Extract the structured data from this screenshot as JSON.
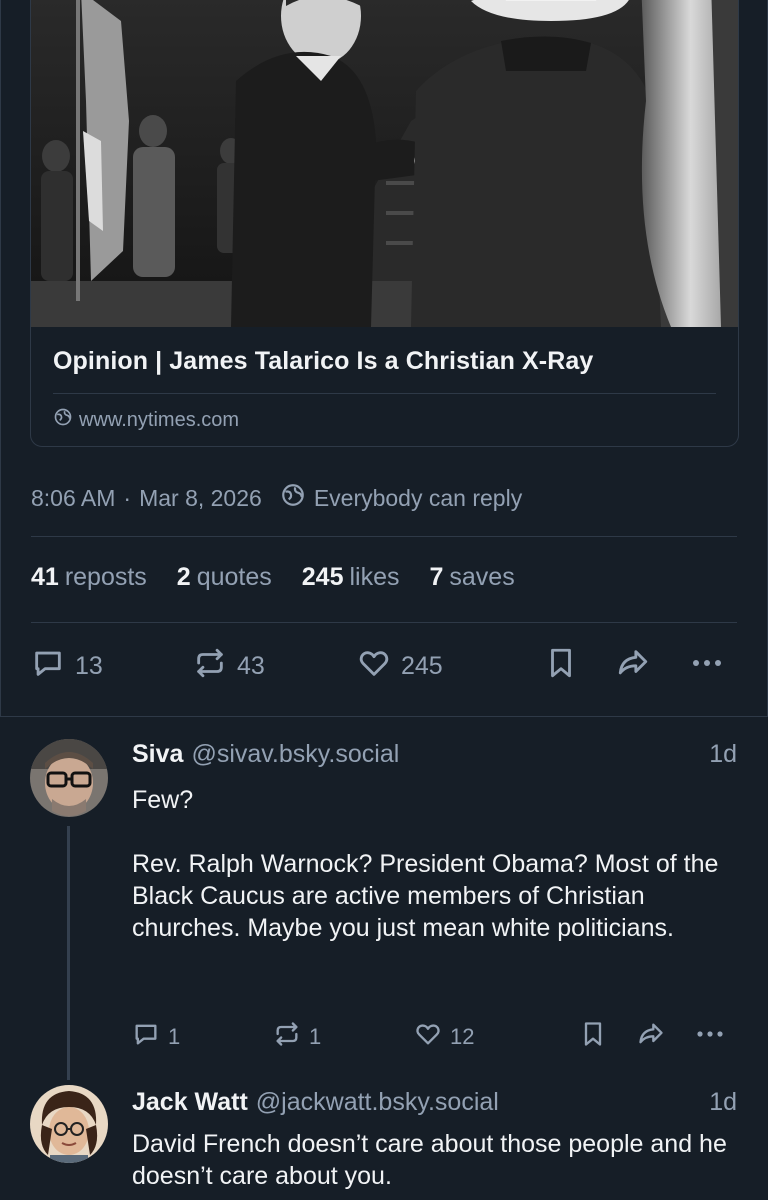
{
  "link_card": {
    "title": "Opinion | James Talarico Is a Christian X-Ray",
    "domain": "www.nytimes.com",
    "image_alt": "Black and white photo of a man in a suit greeting a man in a cowboy hat on a stage with flags"
  },
  "post_meta": {
    "time": "8:06 AM",
    "separator": "·",
    "date": "Mar 8, 2026",
    "reply_setting": "Everybody can reply"
  },
  "stats": {
    "reposts_count": "41",
    "reposts_label": "reposts",
    "quotes_count": "2",
    "quotes_label": "quotes",
    "likes_count": "245",
    "likes_label": "likes",
    "saves_count": "7",
    "saves_label": "saves"
  },
  "actions": {
    "replies": "13",
    "reposts": "43",
    "likes": "245"
  },
  "replies": [
    {
      "name": "Siva",
      "handle": "@sivav.bsky.social",
      "time": "1d",
      "body": "Few?\n\nRev. Ralph Warnock? President Obama? Most of the Black Caucus are active members of Christian churches. Maybe you just mean white politicians.",
      "reply_count": "1",
      "repost_count": "1",
      "like_count": "12"
    },
    {
      "name": "Jack Watt",
      "handle": "@jackwatt.bsky.social",
      "time": "1d",
      "body": "David French doesn’t care about those people and he doesn’t care about you."
    }
  ],
  "colors": {
    "background": "#161e27",
    "border": "#2e3947",
    "text_primary": "#f1f3f5",
    "text_secondary": "#93a1b3"
  }
}
